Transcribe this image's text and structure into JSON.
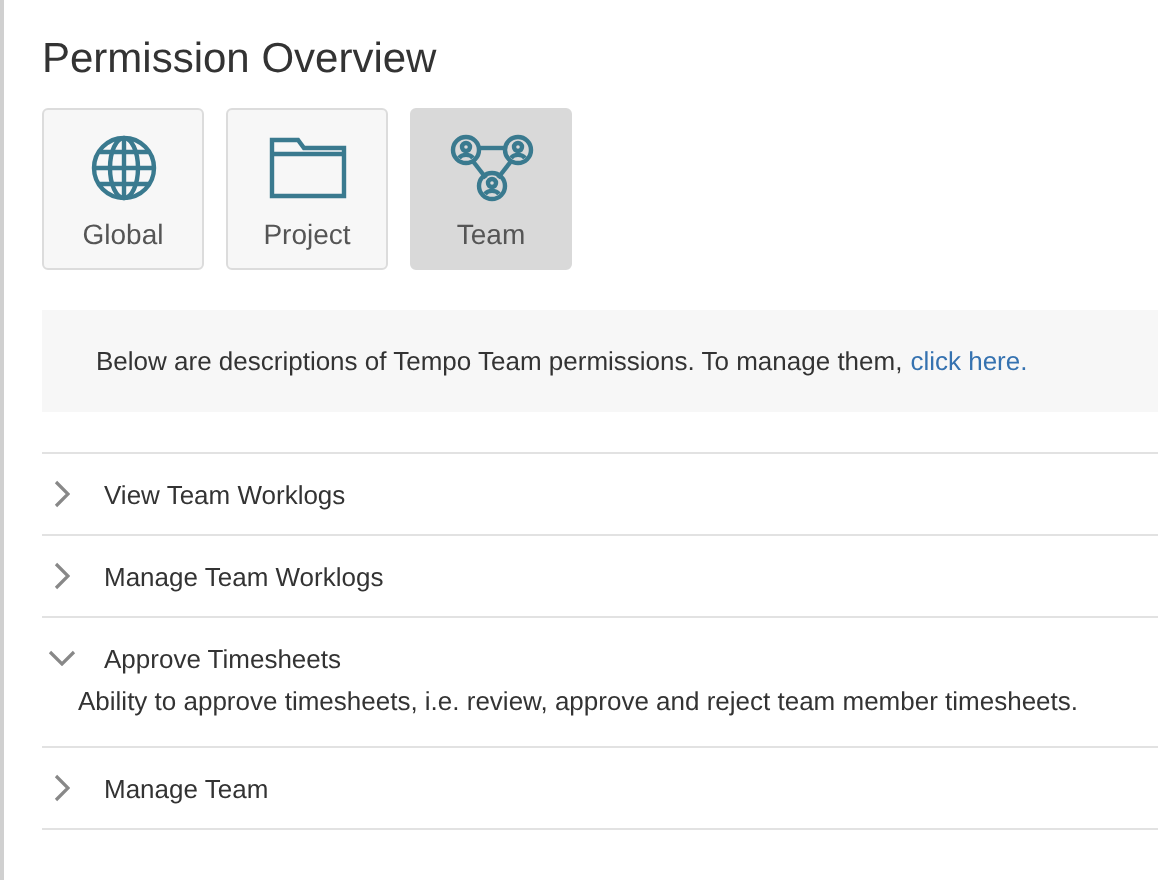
{
  "title": "Permission Overview",
  "scopes": [
    {
      "kind": "globe",
      "label": "Global",
      "selected": false
    },
    {
      "kind": "folder",
      "label": "Project",
      "selected": false
    },
    {
      "kind": "team",
      "label": "Team",
      "selected": true
    }
  ],
  "notice": {
    "text": "Below are descriptions of Tempo Team permissions. To manage them,",
    "link": "click here."
  },
  "permissions": [
    {
      "name": "View Team Worklogs",
      "expanded": false
    },
    {
      "name": "Manage Team Worklogs",
      "expanded": false
    },
    {
      "name": "Approve Timesheets",
      "expanded": true,
      "description": "Ability to approve timesheets, i.e. review, approve and reject team member timesheets."
    },
    {
      "name": "Manage Team",
      "expanded": false
    }
  ]
}
